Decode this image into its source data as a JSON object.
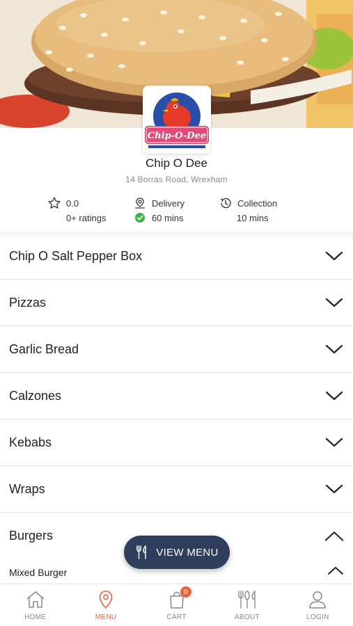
{
  "store": {
    "name": "Chip O Dee",
    "address": "14 Borras Road, Wrexham",
    "logo_text": "Chip-O-Dee"
  },
  "stats": {
    "rating": "0.0",
    "ratings_count": "0+ ratings",
    "delivery_label": "Delivery",
    "delivery_time": "60 mins",
    "collection_label": "Collection",
    "collection_time": "10 mins"
  },
  "categories": [
    {
      "label": "Chip O Salt Pepper Box",
      "expanded": false
    },
    {
      "label": "Pizzas",
      "expanded": false
    },
    {
      "label": "Garlic Bread",
      "expanded": false
    },
    {
      "label": "Calzones",
      "expanded": false
    },
    {
      "label": "Kebabs",
      "expanded": false
    },
    {
      "label": "Wraps",
      "expanded": false
    },
    {
      "label": "Burgers",
      "expanded": true
    }
  ],
  "subcategory": {
    "label": "Mixed Burger",
    "expanded": true
  },
  "view_menu_label": "VIEW MENU",
  "nav": {
    "home": "HOME",
    "menu": "MENU",
    "cart": "CART",
    "cart_count": "0",
    "about": "ABOUT",
    "login": "LOGIN"
  },
  "colors": {
    "accent": "#e8623a",
    "button": "#2e3e5c",
    "check": "#3bb54a"
  }
}
